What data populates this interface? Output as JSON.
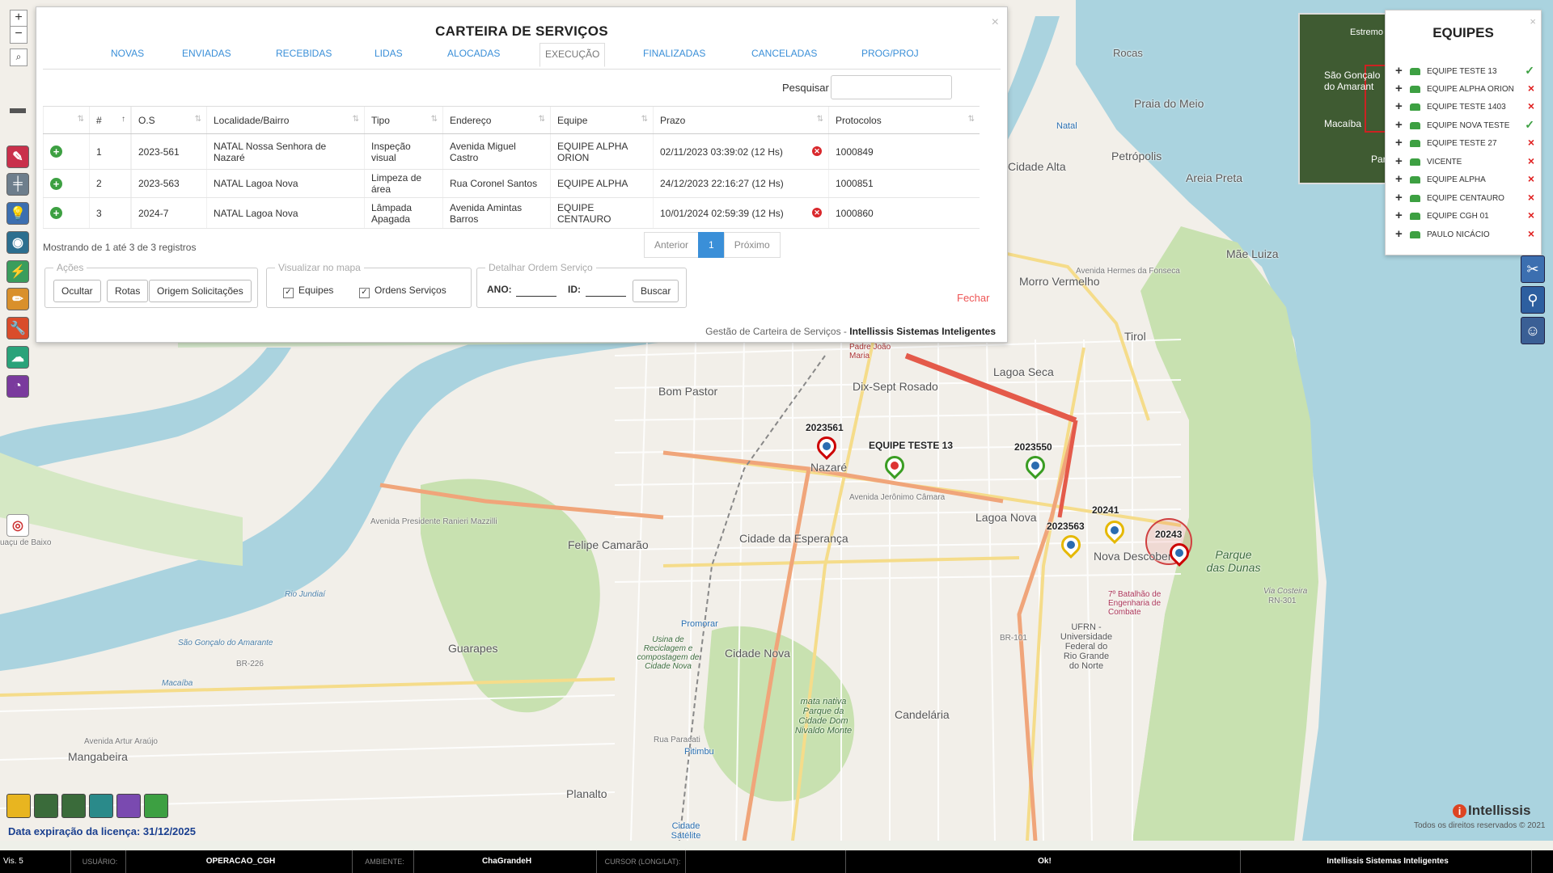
{
  "map": {
    "labels": {
      "rocas": "Rocas",
      "natal": "Natal",
      "praia_do_meio": "Praia do Meio",
      "cidade_alta": "Cidade Alta",
      "petropolis": "Petrópolis",
      "areia_preta": "Areia Preta",
      "mae_luiza": "Mãe Luiza",
      "morro_vermelho": "Morro Vermelho",
      "tirol": "Tirol",
      "padre_joao_maria": "Padre João Maria",
      "dix_sept_rosado": "Dix-Sept Rosado",
      "lagoa_seca": "Lagoa Seca",
      "bom_pastor": "Bom Pastor",
      "nazare": "Nazaré",
      "lagoa_nova": "Lagoa Nova",
      "nova_descoberta": "Nova Descoberta",
      "parque_das_dunas": "Parque das Dunas",
      "felipe_camarao": "Felipe Camarão",
      "cidade_da_esperanca": "Cidade da Esperança",
      "guarapes": "Guarapes",
      "cidade_nova": "Cidade Nova",
      "candelaria": "Candelária",
      "planalto": "Planalto",
      "mangabeira": "Mangabeira",
      "promorar": "Promorar",
      "pitimbu": "Pitimbu",
      "cidade_satelite": "Cidade Satélite",
      "usina": "Usina de Reciclagem e compostagem de Cidade Nova",
      "mata": "mata nativa Parque da Cidade Dom Nivaldo Monte",
      "batalhao": "7º Batalhão de Engenharia de Combate",
      "ufrn": "UFRN - Universidade Federal do Rio Grande do Norte",
      "br101": "BR-101",
      "br226": "BR-226",
      "rn301": "RN-301",
      "via_costeira": "Via Costeira",
      "rio_jundiai": "Rio Jundiaí",
      "macaiba": "Macaíba",
      "sao_goncalo": "São Gonçalo do Amarante",
      "av_ranieri": "Avenida Presidente Ranieri Mazzilli",
      "av_jeronimo": "Avenida Jerônimo Câmara",
      "av_hermes": "Avenida Hermes da Fonseca",
      "av_artur": "Avenida Artur Araújo",
      "rua_paracati": "Rua Paracati",
      "uacu": "uaçu de Baixo"
    },
    "markers": [
      {
        "label": "2023561",
        "color": "red"
      },
      {
        "label": "EQUIPE TESTE 13",
        "color": "green"
      },
      {
        "label": "2023550",
        "color": "green"
      },
      {
        "label": "20241",
        "color": "yellow"
      },
      {
        "label": "2023563",
        "color": "yellow"
      },
      {
        "label": "20243",
        "color": "red"
      }
    ],
    "minimap_labels": {
      "a": "Estremo",
      "b": "São Gonçalo do Amarant",
      "c": "Macaíba",
      "d": "Parn"
    }
  },
  "panel": {
    "title": "CARTEIRA DE SERVIÇOS",
    "tabs": [
      "NOVAS",
      "ENVIADAS",
      "RECEBIDAS",
      "LIDAS",
      "ALOCADAS",
      "EXECUÇÃO",
      "FINALIZADAS",
      "CANCELADAS",
      "PROG/PROJ"
    ],
    "active_tab": "EXECUÇÃO",
    "search_label": "Pesquisar",
    "search_value": "",
    "columns": [
      "",
      "#",
      "",
      "O.S",
      "Localidade/Bairro",
      "Tipo",
      "Endereço",
      "Equipe",
      "Prazo",
      "Protocolos"
    ],
    "rows": [
      {
        "num": "1",
        "os": "2023-561",
        "local": "NATAL Nossa Senhora de Nazaré",
        "tipo": "Inspeção visual",
        "endereco": "Avenida Miguel Castro",
        "equipe": "EQUIPE ALPHA ORION",
        "prazo": "02/11/2023 03:39:02 (12 Hs)",
        "late": true,
        "protocolo": "1000849"
      },
      {
        "num": "2",
        "os": "2023-563",
        "local": "NATAL Lagoa Nova",
        "tipo": "Limpeza de área",
        "endereco": "Rua Coronel Santos",
        "equipe": "EQUIPE ALPHA",
        "prazo": "24/12/2023 22:16:27 (12 Hs)",
        "late": false,
        "protocolo": "1000851"
      },
      {
        "num": "3",
        "os": "2024-7",
        "local": "NATAL Lagoa Nova",
        "tipo": "Lâmpada Apagada",
        "endereco": "Avenida Amintas Barros",
        "equipe": "EQUIPE CENTAURO",
        "prazo": "10/01/2024 02:59:39 (12 Hs)",
        "late": true,
        "protocolo": "1000860"
      }
    ],
    "info": "Mostrando de 1 até 3 de 3 registros",
    "pager": {
      "prev": "Anterior",
      "current": "1",
      "next": "Próximo"
    },
    "acoes": {
      "legend": "Ações",
      "ocultar": "Ocultar",
      "rotas": "Rotas",
      "origem": "Origem Solicitações"
    },
    "visualizar": {
      "legend": "Visualizar no mapa",
      "equipes": "Equipes",
      "ordens": "Ordens Serviços"
    },
    "detalhar": {
      "legend": "Detalhar Ordem Serviço",
      "ano": "ANO:",
      "id": "ID:",
      "buscar": "Buscar"
    },
    "fechar": "Fechar",
    "footer_pre": "Gestão de Carteira de Serviços - ",
    "footer_brand": "Intellissis Sistemas Inteligentes"
  },
  "equipes": {
    "title": "EQUIPES",
    "items": [
      {
        "name": "EQUIPE TESTE 13",
        "ok": true
      },
      {
        "name": "EQUIPE ALPHA ORION",
        "ok": false
      },
      {
        "name": "EQUIPE TESTE 1403",
        "ok": false
      },
      {
        "name": "EQUIPE NOVA TESTE",
        "ok": true
      },
      {
        "name": "EQUIPE TESTE 27",
        "ok": false
      },
      {
        "name": "VICENTE",
        "ok": false
      },
      {
        "name": "EQUIPE ALPHA",
        "ok": false
      },
      {
        "name": "EQUIPE CENTAURO",
        "ok": false
      },
      {
        "name": "EQUIPE CGH 01",
        "ok": false
      },
      {
        "name": "PAULO NICÁCIO",
        "ok": false
      }
    ]
  },
  "license": "Data expiração da licença: 31/12/2025",
  "brand": "Intellissis",
  "rights": "Todos os direitos reservados © 2021",
  "statusbar": {
    "vis": "Vis. 5",
    "usuario_label": "USUÁRIO:",
    "usuario": "OPERACAO_CGH",
    "ambiente_label": "AMBIENTE:",
    "ambiente": "ChaGrandeH",
    "cursor_label": "CURSOR (LONG/LAT):",
    "cursor": "",
    "msg": "Ok!",
    "company": "Intellissis Sistemas Inteligentes"
  },
  "colors": {
    "accent": "#3a8fd8",
    "ok": "#3da042",
    "error": "#e02020",
    "water": "#aad3df",
    "park": "#c8e1b0"
  }
}
